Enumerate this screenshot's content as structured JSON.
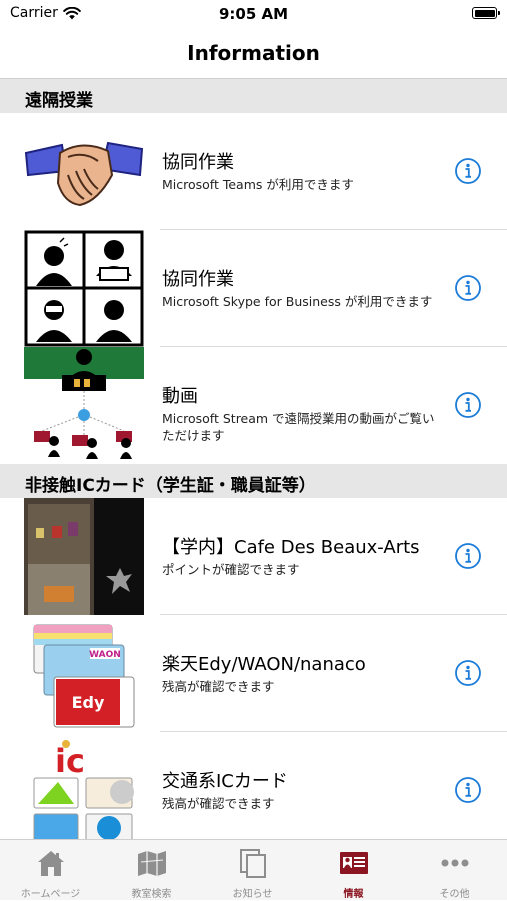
{
  "status": {
    "carrier": "Carrier",
    "time": "9:05 AM"
  },
  "nav": {
    "title": "Information"
  },
  "sections": [
    {
      "header": "遠隔授業"
    },
    {
      "header": "非接触ICカード（学生証・職員証等）"
    }
  ],
  "rows": [
    {
      "title": "協同作業",
      "subtitle": "Microsoft Teams が利用できます",
      "icon": "handshake-icon"
    },
    {
      "title": "協同作業",
      "subtitle": "Microsoft Skype for Business が利用できます",
      "icon": "video-conference-icon"
    },
    {
      "title": "動画",
      "subtitle": "Microsoft Stream で遠隔授業用の動画がご覧いただけます",
      "icon": "lecture-stream-icon"
    },
    {
      "title": "【学内】Cafe Des Beaux-Arts",
      "subtitle": "ポイントが確認できます",
      "icon": "cafe-photo"
    },
    {
      "title": "楽天Edy/WAON/nanaco",
      "subtitle": "残高が確認できます",
      "icon": "emoney-cards-icon",
      "card_labels": [
        "WAON",
        "Edy"
      ]
    },
    {
      "title": "交通系ICカード",
      "subtitle": "残高が確認できます",
      "icon": "transit-ic-icon",
      "card_labels": [
        "ic"
      ]
    }
  ],
  "tabs": [
    {
      "label": "ホームページ",
      "icon": "home-icon",
      "active": false
    },
    {
      "label": "教室検索",
      "icon": "map-icon",
      "active": false
    },
    {
      "label": "お知らせ",
      "icon": "notice-icon",
      "active": false
    },
    {
      "label": "情報",
      "icon": "id-card-icon",
      "active": true
    },
    {
      "label": "その他",
      "icon": "more-icon",
      "active": false
    }
  ],
  "colors": {
    "tint": "#1a7bd8",
    "active_tab": "#8b1520",
    "inactive_tab": "#8e8e8e",
    "section_bg": "#e6e6e6"
  }
}
